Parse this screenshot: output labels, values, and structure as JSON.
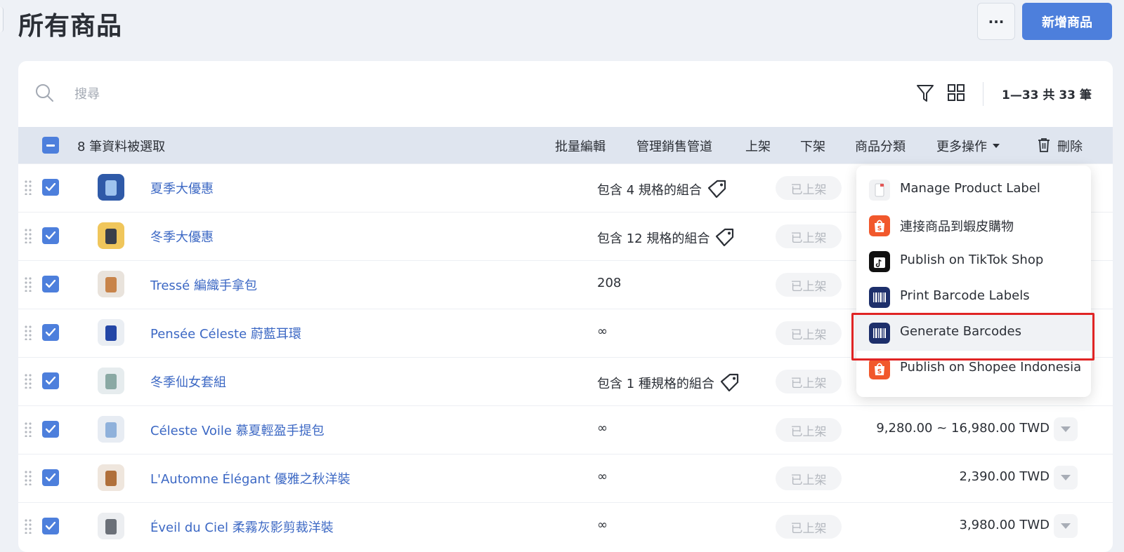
{
  "header": {
    "title": "所有商品",
    "more_label": "···",
    "add_label": "新增商品"
  },
  "search": {
    "placeholder": "搜尋",
    "pagination": "1—33 共 33 筆"
  },
  "bulk": {
    "selected_text": "8 筆資料被選取",
    "actions": [
      "批量編輯",
      "管理銷售管道",
      "上架",
      "下架",
      "商品分類",
      "更多操作",
      "刪除"
    ]
  },
  "rows": [
    {
      "name": "夏季大優惠",
      "stock": "包含 4 規格的組合",
      "has_tag": true,
      "status": "已上架",
      "price": ""
    },
    {
      "name": "冬季大優惠",
      "stock": "包含 12 規格的組合",
      "has_tag": true,
      "status": "已上架",
      "price": ""
    },
    {
      "name": "Tressé 編織手拿包",
      "stock": "208",
      "has_tag": false,
      "status": "已上架",
      "price": ""
    },
    {
      "name": "Pensée Céleste 蔚藍耳環",
      "stock": "∞",
      "has_tag": false,
      "status": "已上架",
      "price": ""
    },
    {
      "name": "冬季仙女套組",
      "stock": "包含 1 種規格的組合",
      "has_tag": true,
      "status": "已上架",
      "price": ""
    },
    {
      "name": "Céleste Voile 慕夏輕盈手提包",
      "stock": "∞",
      "has_tag": false,
      "status": "已上架",
      "price": "9,280.00 ~ 16,980.00 TWD"
    },
    {
      "name": "L'Automne Élégant 優雅之秋洋裝",
      "stock": "∞",
      "has_tag": false,
      "status": "已上架",
      "price": "2,390.00 TWD"
    },
    {
      "name": "Éveil du Ciel 柔霧灰影剪裁洋裝",
      "stock": "∞",
      "has_tag": false,
      "status": "已上架",
      "price": "3,980.00 TWD"
    }
  ],
  "menu": {
    "items": [
      {
        "label": "Manage Product Label",
        "icon": "product-label-icon"
      },
      {
        "label": "連接商品到蝦皮購物",
        "icon": "shopee-icon"
      },
      {
        "label": "Publish on TikTok Shop",
        "icon": "tiktok-icon"
      },
      {
        "label": "Print Barcode Labels",
        "icon": "barcode-icon"
      },
      {
        "label": "Generate Barcodes",
        "icon": "barcode-icon"
      },
      {
        "label": "Publish on Shopee Indonesia",
        "icon": "shopee-icon"
      }
    ],
    "highlighted_index": 4
  },
  "colors": {
    "accent": "#4d7fdc",
    "link": "#3c68c4",
    "highlight_box": "#e02424",
    "shopee": "#f1582c",
    "barcode_bg": "#1d2f6b"
  }
}
